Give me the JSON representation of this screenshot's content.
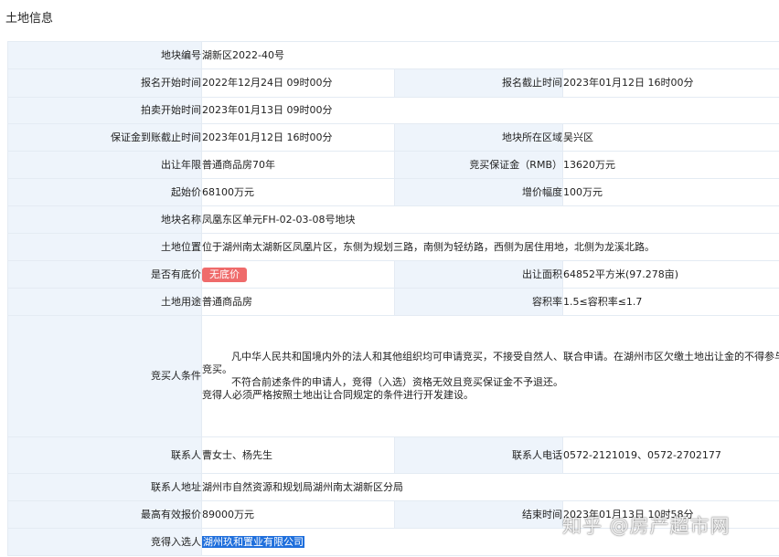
{
  "section_title": "土地信息",
  "fields": {
    "parcel_no": {
      "label": "地块编号",
      "value": "湖新区2022-40号"
    },
    "reg_start": {
      "label": "报名开始时间",
      "value": "2022年12月24日 09时00分"
    },
    "reg_end": {
      "label": "报名截止时间",
      "value": "2023年01月12日 16时00分"
    },
    "auction_start": {
      "label": "拍卖开始时间",
      "value": "2023年01月13日 09时00分"
    },
    "deposit_deadline": {
      "label": "保证金到账截止时间",
      "value": "2023年01月12日 16时00分"
    },
    "district": {
      "label": "地块所在区域",
      "value": "吴兴区"
    },
    "term": {
      "label": "出让年限",
      "value": "普通商品房70年"
    },
    "deposit": {
      "label": "竞买保证金（RMB）",
      "value": "13620万元"
    },
    "start_price": {
      "label": "起始价",
      "value": "68100万元"
    },
    "increment": {
      "label": "增价幅度",
      "value": "100万元"
    },
    "parcel_name": {
      "label": "地块名称",
      "value": "凤凰东区单元FH-02-03-08号地块"
    },
    "location": {
      "label": "土地位置",
      "value": "位于湖州南太湖新区凤凰片区，东侧为规划三路，南侧为轻纺路，西侧为居住用地，北侧为龙溪北路。"
    },
    "reserve": {
      "label": "是否有底价",
      "value": "无底价"
    },
    "area": {
      "label": "出让面积",
      "value": "64852平方米(97.278亩)"
    },
    "usage": {
      "label": "土地用途",
      "value": "普通商品房"
    },
    "far": {
      "label": "容积率",
      "value": "1.5≤容积率≤1.7"
    },
    "bidder_cond": {
      "label": "竞买人条件",
      "lines": [
        "凡中华人民共和国境内外的法人和其他组织均可申请竞买，不接受自然人、联合申请。在湖州市区欠缴土地出让金的不得参与竞买。",
        "不符合前述条件的申请人，竞得（入选）资格无效且竞买保证金不予退还。",
        "竞得人必须严格按照土地出让合同规定的条件进行开发建设。"
      ]
    },
    "contact": {
      "label": "联系人",
      "value": "曹女士、杨先生"
    },
    "phone": {
      "label": "联系人电话",
      "value": "0572-2121019、0572-2702177"
    },
    "address": {
      "label": "联系人地址",
      "value": "湖州市自然资源和规划局湖州南太湖新区分局"
    },
    "top_bid": {
      "label": "最高有效报价",
      "value": "89000万元"
    },
    "end_time": {
      "label": "结束时间",
      "value": "2023年01月13日 10时58分"
    },
    "winner": {
      "label": "竞得入选人",
      "value": "湖州玖和置业有限公司"
    }
  },
  "watermark": "知乎 @房产超市网"
}
